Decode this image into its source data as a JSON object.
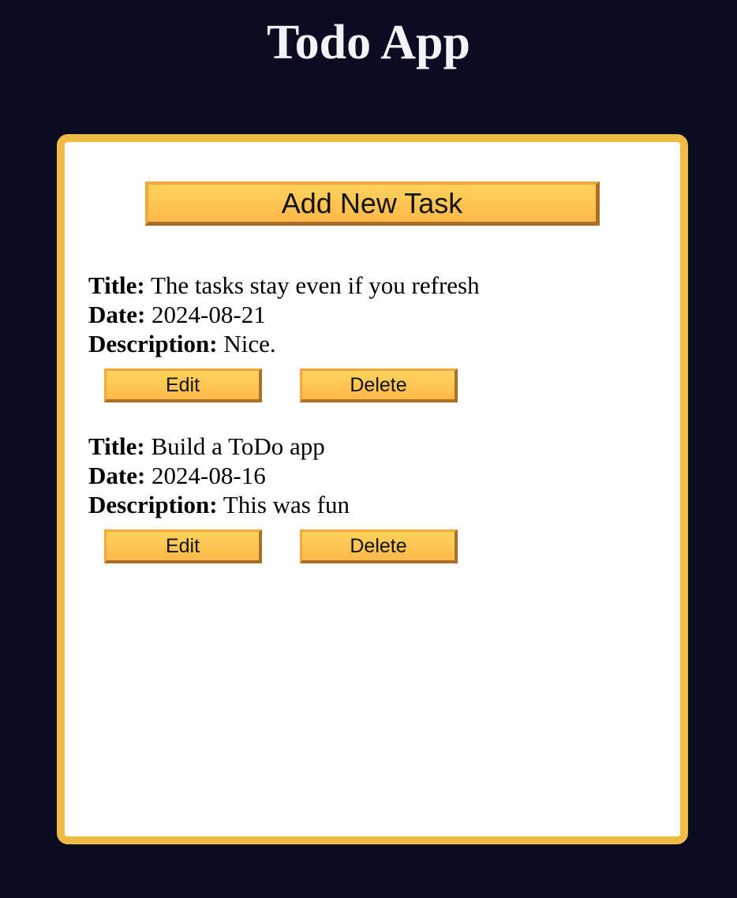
{
  "app": {
    "title": "Todo App"
  },
  "toolbar": {
    "add_label": "Add New Task"
  },
  "fields": {
    "title_label": "Title:",
    "date_label": "Date:",
    "description_label": "Description:"
  },
  "tasks": [
    {
      "title": "The tasks stay even if you refresh",
      "date": "2024-08-21",
      "description": "Nice.",
      "edit_label": "Edit",
      "delete_label": "Delete"
    },
    {
      "title": "Build a ToDo app",
      "date": "2024-08-16",
      "description": "This was fun",
      "edit_label": "Edit",
      "delete_label": "Delete"
    }
  ],
  "colors": {
    "page_background": "#0a0c22",
    "panel_border": "#f0bb44",
    "button_top": "#ffd25c",
    "button_bottom": "#ffb84a"
  }
}
